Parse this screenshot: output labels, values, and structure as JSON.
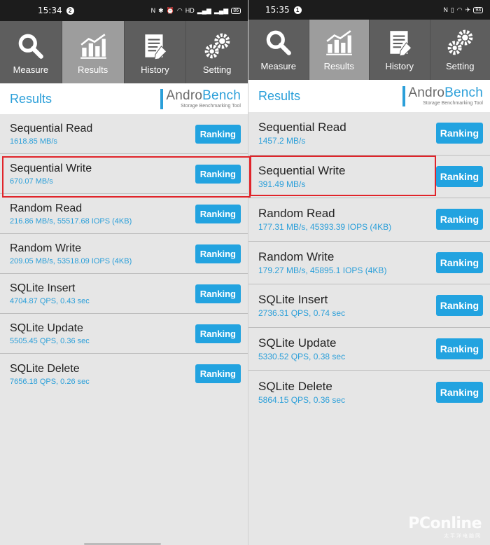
{
  "left": {
    "status": {
      "time": "15:34",
      "notif": "2",
      "battery": "86"
    },
    "tabs": [
      {
        "label": "Measure",
        "icon": "magnifier-icon",
        "active": false
      },
      {
        "label": "Results",
        "icon": "chart-icon",
        "active": true
      },
      {
        "label": "History",
        "icon": "document-icon",
        "active": false
      },
      {
        "label": "Setting",
        "icon": "gears-icon",
        "active": false
      }
    ],
    "header": {
      "title": "Results",
      "brand_a": "Andro",
      "brand_b": "Bench",
      "tagline": "Storage Benchmarking Tool"
    },
    "rows": [
      {
        "name": "Sequential Read",
        "value": "1618.85 MB/s",
        "button": "Ranking"
      },
      {
        "name": "Sequential Write",
        "value": "670.07 MB/s",
        "button": "Ranking"
      },
      {
        "name": "Random Read",
        "value": "216.86 MB/s, 55517.68 IOPS (4KB)",
        "button": "Ranking"
      },
      {
        "name": "Random Write",
        "value": "209.05 MB/s, 53518.09 IOPS (4KB)",
        "button": "Ranking"
      },
      {
        "name": "SQLite Insert",
        "value": "4704.87 QPS, 0.43 sec",
        "button": "Ranking"
      },
      {
        "name": "SQLite Update",
        "value": "5505.45 QPS, 0.36 sec",
        "button": "Ranking"
      },
      {
        "name": "SQLite Delete",
        "value": "7656.18 QPS, 0.26 sec",
        "button": "Ranking"
      }
    ]
  },
  "right": {
    "status": {
      "time": "15:35",
      "notif": "1",
      "battery": "93"
    },
    "tabs": [
      {
        "label": "Measure",
        "icon": "magnifier-icon",
        "active": false
      },
      {
        "label": "Results",
        "icon": "chart-icon",
        "active": true
      },
      {
        "label": "History",
        "icon": "document-icon",
        "active": false
      },
      {
        "label": "Setting",
        "icon": "gears-icon",
        "active": false
      }
    ],
    "header": {
      "title": "Results",
      "brand_a": "Andro",
      "brand_b": "Bench",
      "tagline": "Storage Benchmarking Tool"
    },
    "rows": [
      {
        "name": "Sequential Read",
        "value": "1457.2 MB/s",
        "button": "Ranking"
      },
      {
        "name": "Sequential Write",
        "value": "391.49 MB/s",
        "button": "Ranking"
      },
      {
        "name": "Random Read",
        "value": "177.31 MB/s, 45393.39 IOPS (4KB)",
        "button": "Ranking"
      },
      {
        "name": "Random Write",
        "value": "179.27 MB/s, 45895.1 IOPS (4KB)",
        "button": "Ranking"
      },
      {
        "name": "SQLite Insert",
        "value": "2736.31 QPS, 0.74 sec",
        "button": "Ranking"
      },
      {
        "name": "SQLite Update",
        "value": "5330.52 QPS, 0.38 sec",
        "button": "Ranking"
      },
      {
        "name": "SQLite Delete",
        "value": "5864.15 QPS, 0.36 sec",
        "button": "Ranking"
      }
    ]
  },
  "watermark": {
    "main": "PConline",
    "sub": "太平洋电脑网"
  },
  "colors": {
    "accent": "#2b9fd9",
    "button": "#22a3e0",
    "highlight": "#e0242a",
    "tabbar": "#5e5e5e",
    "tab_active": "#9d9d9d"
  }
}
